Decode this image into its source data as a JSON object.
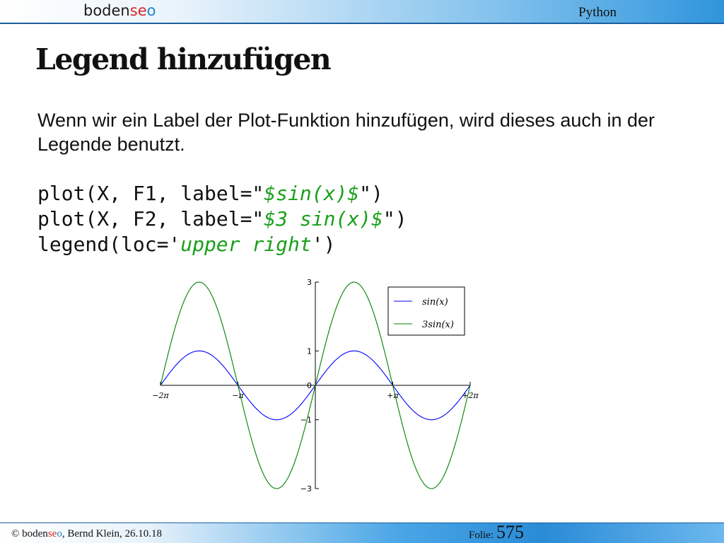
{
  "header": {
    "brand_parts": [
      "boden",
      "se",
      "o"
    ],
    "topic": "Python"
  },
  "slide": {
    "title": "Legend hinzufügen",
    "paragraph": "Wenn wir ein Label der Plot-Funktion hinzufügen, wird dieses auch in der Legende benutzt.",
    "code": [
      {
        "prefix": "plot(X, F1, label=\"",
        "string": "$sin(x)$",
        "suffix": "\")"
      },
      {
        "prefix": "plot(X, F2, label=\"",
        "string": "$3 sin(x)$",
        "suffix": "\")"
      },
      {
        "prefix": "legend(loc='",
        "string": "upper right",
        "suffix": "')"
      }
    ]
  },
  "chart_data": {
    "type": "line",
    "x_range": [
      -6.2832,
      6.2832
    ],
    "ylim": [
      -3,
      3
    ],
    "x_tick_labels": [
      "−2π",
      "−π",
      "+π",
      "+2π"
    ],
    "x_tick_values": [
      -6.2832,
      -3.1416,
      3.1416,
      6.2832
    ],
    "y_ticks": [
      3,
      1,
      0,
      -1,
      -3
    ],
    "y_tick_labels": [
      "3",
      "1",
      "0",
      "−1",
      "−3"
    ],
    "legend_position": "upper right",
    "series": [
      {
        "name": "sin(x)",
        "color": "#0000ff",
        "amplitude": 1
      },
      {
        "name": "3sin(x)",
        "color": "#008000",
        "amplitude": 3
      }
    ],
    "grid": false
  },
  "footer": {
    "copyright_parts": [
      "© boden",
      "se",
      "o",
      ", Bernd Klein, 26.10.18"
    ],
    "slide_label": "Folie:",
    "slide_number": "575"
  }
}
